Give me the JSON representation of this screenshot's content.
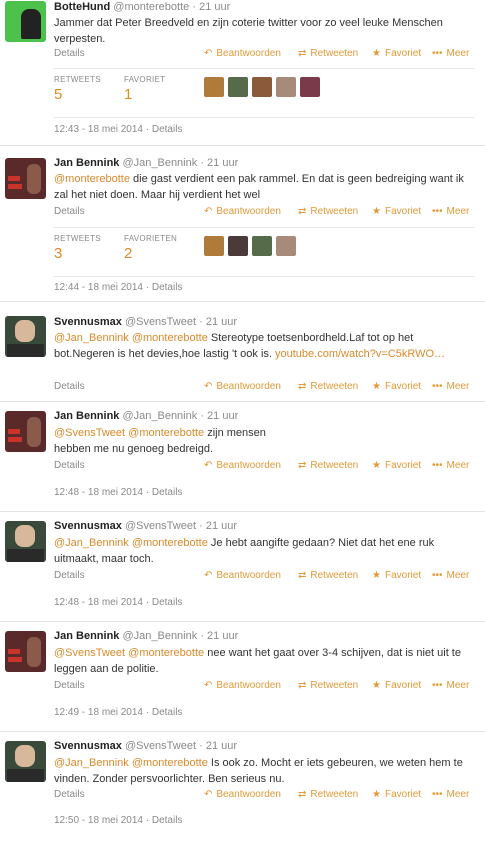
{
  "colors": {
    "accent": "#d98a2b",
    "muted": "#8a8a8a"
  },
  "labels": {
    "details": "Details",
    "reply": "Beantwoorden",
    "retweet": "Retweeten",
    "favorite": "Favoriet",
    "more": "Meer",
    "dot": "·"
  },
  "t1": {
    "name": "BotteHund",
    "handle": "@monterebotte",
    "time": "21 uur",
    "text": "Jammer dat Peter Breedveld en zijn coterie twitter voor zo veel leuke Menschen verpesten.",
    "retweets_label": "RETWEETS",
    "retweets": "5",
    "favs_label": "FAVORIET",
    "favs": "1",
    "stamp": "12:43 - 18 mei 2014"
  },
  "t2": {
    "name": "Jan Bennink",
    "handle": "@Jan_Bennink",
    "time": "21 uur",
    "mention": "@monterebotte",
    "text": " die gast verdient een pak rammel. En dat is geen bedreiging want ik zal het niet doen. Maar hij verdient het wel",
    "retweets_label": "RETWEETS",
    "retweets": "3",
    "favs_label": "FAVORIETEN",
    "favs": "2",
    "stamp": "12:44 - 18 mei 2014"
  },
  "t3": {
    "name": "Svennusmax",
    "handle": "@SvensTweet",
    "time": "21 uur",
    "m1": "@Jan_Bennink",
    "m2": "@monterebotte",
    "text": " Stereotype toetsenbordheld.Laf tot op het bot.Negeren is het devies,hoe lastig 't ook is. ",
    "link": "youtube.com/watch?v=C5kRWO…"
  },
  "t4": {
    "name": "Jan Bennink",
    "handle": "@Jan_Bennink",
    "time": "21 uur",
    "m1": "@SvensTweet",
    "m2": "@monterebotte",
    "text": " zijn mensen hebben me nu genoeg bedreigd.",
    "stamp": "12:48 - 18 mei 2014"
  },
  "t5": {
    "name": "Svennusmax",
    "handle": "@SvensTweet",
    "time": "21 uur",
    "m1": "@Jan_Bennink",
    "m2": "@monterebotte",
    "text": " Je hebt aangifte gedaan? Niet dat het ene ruk uitmaakt, maar toch.",
    "stamp": "12:48 - 18 mei 2014"
  },
  "t6": {
    "name": "Jan Bennink",
    "handle": "@Jan_Bennink",
    "time": "21 uur",
    "m1": "@SvensTweet",
    "m2": "@monterebotte",
    "text": " nee want het gaat over 3-4 schijven, dat is niet uit te leggen aan de politie.",
    "stamp": "12:49 - 18 mei 2014"
  },
  "t7": {
    "name": "Svennusmax",
    "handle": "@SvensTweet",
    "time": "21 uur",
    "m1": "@Jan_Bennink",
    "m2": "@monterebotte",
    "text": " Is ook zo. Mocht er iets gebeuren, we weten hem te vinden. Zonder persvoorlichter. Ben serieus nu.",
    "stamp": "12:50 - 18 mei 2014"
  }
}
